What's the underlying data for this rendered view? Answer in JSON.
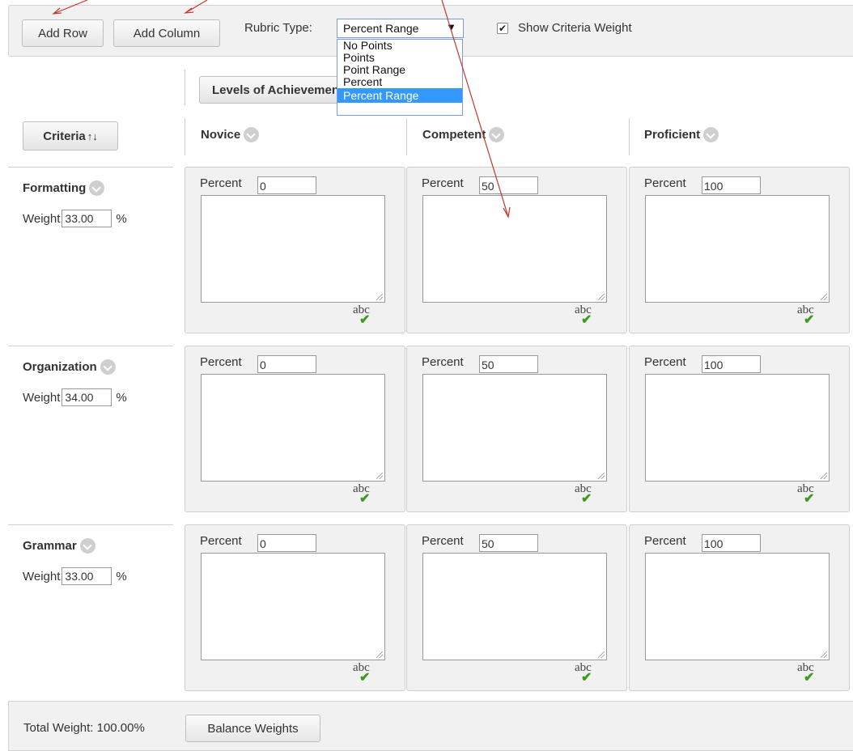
{
  "toolbar": {
    "add_row": "Add Row",
    "add_column": "Add Column",
    "rubric_type_label": "Rubric Type:",
    "rubric_type_value": "Percent Range",
    "rubric_type_arrow": "▼",
    "options": [
      "No Points",
      "Points",
      "Point Range",
      "Percent",
      "Percent Range"
    ],
    "show_weight_label": "Show Criteria Weight",
    "show_weight_checked": true
  },
  "grid": {
    "levels_button": "Levels of Achievement",
    "criteria_button": "Criteria",
    "sort_icon": "↑↓",
    "levels": [
      "Novice",
      "Competent",
      "Proficient"
    ],
    "percent_label": "Percent",
    "weight_label": "Weight",
    "weight_unit": "%",
    "spell_text": "abc",
    "spell_tick": "✔",
    "rows": [
      {
        "name": "Formatting",
        "weight": "33.00",
        "percents": [
          "0",
          "50",
          "100"
        ]
      },
      {
        "name": "Organization",
        "weight": "34.00",
        "percents": [
          "0",
          "50",
          "100"
        ]
      },
      {
        "name": "Grammar",
        "weight": "33.00",
        "percents": [
          "0",
          "50",
          "100"
        ]
      }
    ]
  },
  "footer": {
    "total_weight": "Total Weight: 100.00%",
    "balance": "Balance Weights"
  },
  "colors": {
    "annotation_arrow": "#c0392b",
    "selection": "#3399ff",
    "spell_check": "#3c9a1e"
  }
}
